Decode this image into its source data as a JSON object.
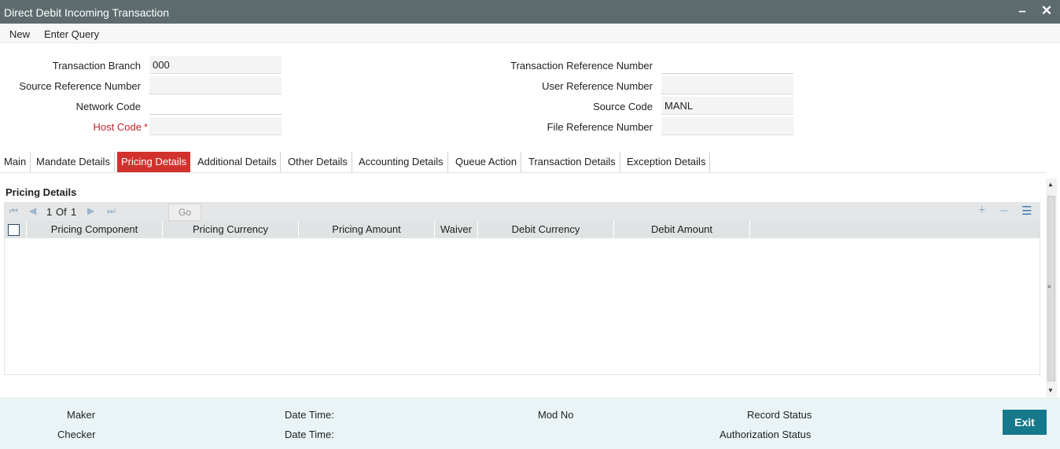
{
  "window": {
    "title": "Direct Debit Incoming Transaction"
  },
  "menu": {
    "new": "New",
    "enter_query": "Enter Query"
  },
  "form": {
    "transaction_branch": {
      "label": "Transaction Branch",
      "value": "000"
    },
    "source_reference_number": {
      "label": "Source Reference Number",
      "value": ""
    },
    "network_code": {
      "label": "Network Code",
      "value": ""
    },
    "host_code": {
      "label": "Host Code",
      "required_mark": "*",
      "value": ""
    },
    "transaction_reference_number": {
      "label": "Transaction Reference Number",
      "value": ""
    },
    "user_reference_number": {
      "label": "User Reference Number",
      "value": ""
    },
    "source_code": {
      "label": "Source Code",
      "value": "MANL"
    },
    "file_reference_number": {
      "label": "File Reference Number",
      "value": ""
    }
  },
  "tabs": [
    {
      "label": "Main"
    },
    {
      "label": "Mandate Details"
    },
    {
      "label": "Pricing Details",
      "active": true
    },
    {
      "label": "Additional Details"
    },
    {
      "label": "Other Details"
    },
    {
      "label": "Accounting Details"
    },
    {
      "label": "Queue Action"
    },
    {
      "label": "Transaction Details"
    },
    {
      "label": "Exception Details"
    }
  ],
  "pricing": {
    "title": "Pricing Details",
    "pager": {
      "current": "1",
      "of_label": "Of",
      "total": "1",
      "go_label": "Go"
    },
    "columns": [
      "Pricing Component",
      "Pricing Currency",
      "Pricing Amount",
      "Waiver",
      "Debit Currency",
      "Debit Amount"
    ],
    "rows": []
  },
  "footer": {
    "maker": "Maker",
    "checker": "Checker",
    "date_time_1": "Date Time:",
    "date_time_2": "Date Time:",
    "mod_no": "Mod No",
    "record_status": "Record Status",
    "authorization_status": "Authorization Status",
    "exit_label": "Exit"
  }
}
